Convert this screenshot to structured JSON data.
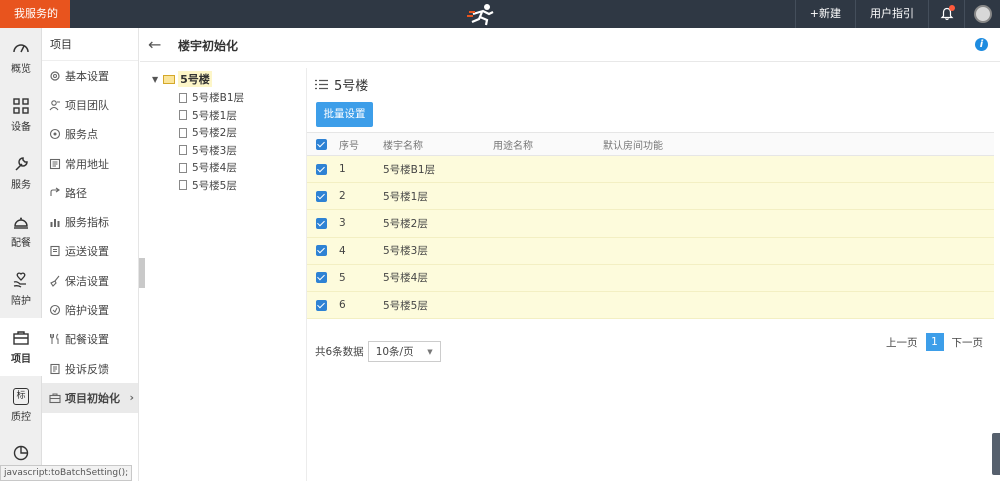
{
  "topbar": {
    "brand": "我服务的",
    "new_label": "+新建",
    "guide_label": "用户指引"
  },
  "rail": [
    {
      "label": "概览",
      "icon": "gauge-icon"
    },
    {
      "label": "设备",
      "icon": "grid-icon"
    },
    {
      "label": "服务",
      "icon": "wrench-icon"
    },
    {
      "label": "配餐",
      "icon": "cloche-icon"
    },
    {
      "label": "陪护",
      "icon": "heart-hands-icon"
    },
    {
      "label": "项目",
      "icon": "briefcase-icon"
    },
    {
      "label": "质控",
      "icon": "badge-icon"
    }
  ],
  "rail_badge_text": "标",
  "submenu": {
    "title": "项目",
    "items": [
      {
        "label": "基本设置"
      },
      {
        "label": "项目团队"
      },
      {
        "label": "服务点"
      },
      {
        "label": "常用地址"
      },
      {
        "label": "路径"
      },
      {
        "label": "服务指标"
      },
      {
        "label": "运送设置"
      },
      {
        "label": "保洁设置"
      },
      {
        "label": "陪护设置"
      },
      {
        "label": "配餐设置"
      },
      {
        "label": "投诉反馈"
      },
      {
        "label": "项目初始化"
      }
    ]
  },
  "page": {
    "title": "楼宇初始化",
    "info_glyph": "i"
  },
  "tree": {
    "root": "5号楼",
    "children": [
      "5号楼B1层",
      "5号楼1层",
      "5号楼2层",
      "5号楼3层",
      "5号楼4层",
      "5号楼5层"
    ]
  },
  "panel": {
    "title": "5号楼",
    "batch_button": "批量设置"
  },
  "table": {
    "headers": [
      "序号",
      "楼宇名称",
      "用途名称",
      "默认房间功能"
    ],
    "rows": [
      {
        "no": "1",
        "name": "5号楼B1层",
        "use": "",
        "func": ""
      },
      {
        "no": "2",
        "name": "5号楼1层",
        "use": "",
        "func": ""
      },
      {
        "no": "3",
        "name": "5号楼2层",
        "use": "",
        "func": ""
      },
      {
        "no": "4",
        "name": "5号楼3层",
        "use": "",
        "func": ""
      },
      {
        "no": "5",
        "name": "5号楼4层",
        "use": "",
        "func": ""
      },
      {
        "no": "6",
        "name": "5号楼5层",
        "use": "",
        "func": ""
      }
    ]
  },
  "pagination": {
    "total": "共6条数据",
    "page_size": "10条/页",
    "prev": "上一页",
    "current": "1",
    "next": "下一页"
  },
  "status_tip": "javascript:toBatchSetting();",
  "colors": {
    "topbar": "#2f3844",
    "brand": "#e8541e",
    "accent": "#3d9ee9",
    "row_highlight": "#fdfbdc"
  }
}
